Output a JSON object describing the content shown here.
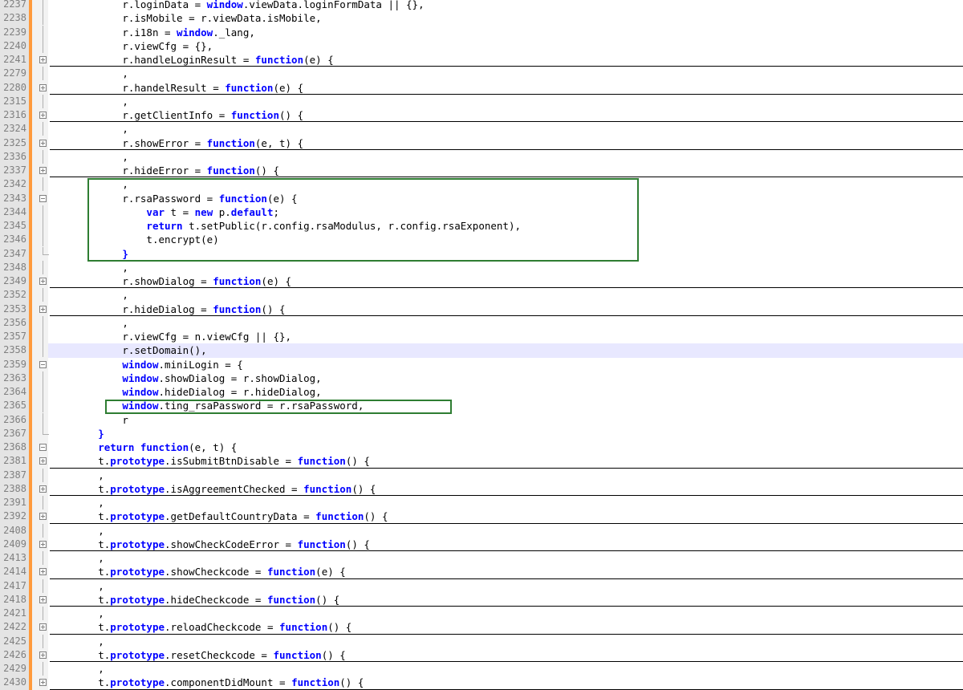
{
  "editor": {
    "lines": [
      {
        "num": "2237",
        "indent": "            ",
        "tokens": [
          {
            "t": "r.loginData = "
          },
          {
            "t": "window",
            "k": 1
          },
          {
            "t": ".viewData.loginFormData || {},"
          }
        ],
        "fold": "line"
      },
      {
        "num": "2238",
        "indent": "            ",
        "tokens": [
          {
            "t": "r.isMobile = r.viewData.isMobile,"
          }
        ],
        "fold": "line"
      },
      {
        "num": "2239",
        "indent": "            ",
        "tokens": [
          {
            "t": "r.i18n = "
          },
          {
            "t": "window",
            "k": 1
          },
          {
            "t": "._lang,"
          }
        ],
        "fold": "line"
      },
      {
        "num": "2240",
        "indent": "            ",
        "tokens": [
          {
            "t": "r.viewCfg = {},"
          }
        ],
        "fold": "line"
      },
      {
        "num": "2241",
        "indent": "            ",
        "tokens": [
          {
            "t": "r.handleLoginResult = "
          },
          {
            "t": "function",
            "k": 1
          },
          {
            "t": "(e) {"
          }
        ],
        "fold": "box",
        "folded": true
      },
      {
        "num": "2279",
        "indent": "            ",
        "tokens": [
          {
            "t": ","
          }
        ],
        "fold": "line"
      },
      {
        "num": "2280",
        "indent": "            ",
        "tokens": [
          {
            "t": "r.handelResult = "
          },
          {
            "t": "function",
            "k": 1
          },
          {
            "t": "(e) {"
          }
        ],
        "fold": "box",
        "folded": true
      },
      {
        "num": "2315",
        "indent": "            ",
        "tokens": [
          {
            "t": ","
          }
        ],
        "fold": "line"
      },
      {
        "num": "2316",
        "indent": "            ",
        "tokens": [
          {
            "t": "r.getClientInfo = "
          },
          {
            "t": "function",
            "k": 1
          },
          {
            "t": "() {"
          }
        ],
        "fold": "box",
        "folded": true
      },
      {
        "num": "2324",
        "indent": "            ",
        "tokens": [
          {
            "t": ","
          }
        ],
        "fold": "line"
      },
      {
        "num": "2325",
        "indent": "            ",
        "tokens": [
          {
            "t": "r.showError = "
          },
          {
            "t": "function",
            "k": 1
          },
          {
            "t": "(e, t) {"
          }
        ],
        "fold": "box",
        "folded": true
      },
      {
        "num": "2336",
        "indent": "            ",
        "tokens": [
          {
            "t": ","
          }
        ],
        "fold": "line"
      },
      {
        "num": "2337",
        "indent": "            ",
        "tokens": [
          {
            "t": "r.hideError = "
          },
          {
            "t": "function",
            "k": 1
          },
          {
            "t": "() {"
          }
        ],
        "fold": "box",
        "folded": true
      },
      {
        "num": "2342",
        "indent": "            ",
        "tokens": [
          {
            "t": ","
          }
        ],
        "fold": "line"
      },
      {
        "num": "2343",
        "indent": "            ",
        "tokens": [
          {
            "t": "r.rsaPassword = "
          },
          {
            "t": "function",
            "k": 1
          },
          {
            "t": "(e) {"
          }
        ],
        "fold": "box"
      },
      {
        "num": "2344",
        "indent": "                ",
        "tokens": [
          {
            "t": "var",
            "k": 1
          },
          {
            "t": " t = "
          },
          {
            "t": "new",
            "k": 1
          },
          {
            "t": " p."
          },
          {
            "t": "default",
            "k": 1
          },
          {
            "t": ";"
          }
        ],
        "fold": "line"
      },
      {
        "num": "2345",
        "indent": "                ",
        "tokens": [
          {
            "t": "return",
            "k": 1
          },
          {
            "t": " t.setPublic(r.config.rsaModulus, r.config.rsaExponent),"
          }
        ],
        "fold": "line"
      },
      {
        "num": "2346",
        "indent": "                ",
        "tokens": [
          {
            "t": "t.encrypt(e)"
          }
        ],
        "fold": "line"
      },
      {
        "num": "2347",
        "indent": "            ",
        "tokens": [
          {
            "t": "}",
            "k": 1
          }
        ],
        "fold": "end"
      },
      {
        "num": "2348",
        "indent": "            ",
        "tokens": [
          {
            "t": ","
          }
        ],
        "fold": "line"
      },
      {
        "num": "2349",
        "indent": "            ",
        "tokens": [
          {
            "t": "r.showDialog = "
          },
          {
            "t": "function",
            "k": 1
          },
          {
            "t": "(e) {"
          }
        ],
        "fold": "box",
        "folded": true
      },
      {
        "num": "2352",
        "indent": "            ",
        "tokens": [
          {
            "t": ","
          }
        ],
        "fold": "line"
      },
      {
        "num": "2353",
        "indent": "            ",
        "tokens": [
          {
            "t": "r.hideDialog = "
          },
          {
            "t": "function",
            "k": 1
          },
          {
            "t": "() {"
          }
        ],
        "fold": "box",
        "folded": true
      },
      {
        "num": "2356",
        "indent": "            ",
        "tokens": [
          {
            "t": ","
          }
        ],
        "fold": "line"
      },
      {
        "num": "2357",
        "indent": "            ",
        "tokens": [
          {
            "t": "r.viewCfg = n.viewCfg || {},"
          }
        ],
        "fold": "line"
      },
      {
        "num": "2358",
        "indent": "            ",
        "tokens": [
          {
            "t": "r.setDomain(),"
          }
        ],
        "fold": "line",
        "current": true
      },
      {
        "num": "2359",
        "indent": "            ",
        "tokens": [
          {
            "t": "window",
            "k": 1
          },
          {
            "t": ".miniLogin = {"
          }
        ],
        "fold": "box"
      },
      {
        "num": "2363",
        "indent": "            ",
        "tokens": [
          {
            "t": "window",
            "k": 1
          },
          {
            "t": ".showDialog = r.showDialog,"
          }
        ],
        "fold": "line"
      },
      {
        "num": "2364",
        "indent": "            ",
        "tokens": [
          {
            "t": "window",
            "k": 1
          },
          {
            "t": ".hideDialog = r.hideDialog,"
          }
        ],
        "fold": "line"
      },
      {
        "num": "2365",
        "indent": "            ",
        "tokens": [
          {
            "t": "window",
            "k": 1
          },
          {
            "t": ".ting_rsaPassword = r.rsaPassword,"
          }
        ],
        "fold": "line"
      },
      {
        "num": "2366",
        "indent": "            ",
        "tokens": [
          {
            "t": "r"
          }
        ],
        "fold": "line"
      },
      {
        "num": "2367",
        "indent": "        ",
        "tokens": [
          {
            "t": "}",
            "k": 1
          }
        ],
        "fold": "end"
      },
      {
        "num": "2368",
        "indent": "        ",
        "tokens": [
          {
            "t": "return",
            "k": 1
          },
          {
            "t": " "
          },
          {
            "t": "function",
            "k": 1
          },
          {
            "t": "(e, t) {"
          }
        ],
        "fold": "box"
      },
      {
        "num": "2381",
        "indent": "        ",
        "tokens": [
          {
            "t": "t."
          },
          {
            "t": "prototype",
            "k": 1
          },
          {
            "t": ".isSubmitBtnDisable = "
          },
          {
            "t": "function",
            "k": 1
          },
          {
            "t": "() {"
          }
        ],
        "fold": "box",
        "folded": true
      },
      {
        "num": "2387",
        "indent": "        ",
        "tokens": [
          {
            "t": ","
          }
        ],
        "fold": "line"
      },
      {
        "num": "2388",
        "indent": "        ",
        "tokens": [
          {
            "t": "t."
          },
          {
            "t": "prototype",
            "k": 1
          },
          {
            "t": ".isAggreementChecked = "
          },
          {
            "t": "function",
            "k": 1
          },
          {
            "t": "() {"
          }
        ],
        "fold": "box",
        "folded": true
      },
      {
        "num": "2391",
        "indent": "        ",
        "tokens": [
          {
            "t": ","
          }
        ],
        "fold": "line"
      },
      {
        "num": "2392",
        "indent": "        ",
        "tokens": [
          {
            "t": "t."
          },
          {
            "t": "prototype",
            "k": 1
          },
          {
            "t": ".getDefaultCountryData = "
          },
          {
            "t": "function",
            "k": 1
          },
          {
            "t": "() {"
          }
        ],
        "fold": "box",
        "folded": true
      },
      {
        "num": "2408",
        "indent": "        ",
        "tokens": [
          {
            "t": ","
          }
        ],
        "fold": "line"
      },
      {
        "num": "2409",
        "indent": "        ",
        "tokens": [
          {
            "t": "t."
          },
          {
            "t": "prototype",
            "k": 1
          },
          {
            "t": ".showCheckCodeError = "
          },
          {
            "t": "function",
            "k": 1
          },
          {
            "t": "() {"
          }
        ],
        "fold": "box",
        "folded": true
      },
      {
        "num": "2413",
        "indent": "        ",
        "tokens": [
          {
            "t": ","
          }
        ],
        "fold": "line"
      },
      {
        "num": "2414",
        "indent": "        ",
        "tokens": [
          {
            "t": "t."
          },
          {
            "t": "prototype",
            "k": 1
          },
          {
            "t": ".showCheckcode = "
          },
          {
            "t": "function",
            "k": 1
          },
          {
            "t": "(e) {"
          }
        ],
        "fold": "box",
        "folded": true
      },
      {
        "num": "2417",
        "indent": "        ",
        "tokens": [
          {
            "t": ","
          }
        ],
        "fold": "line"
      },
      {
        "num": "2418",
        "indent": "        ",
        "tokens": [
          {
            "t": "t."
          },
          {
            "t": "prototype",
            "k": 1
          },
          {
            "t": ".hideCheckcode = "
          },
          {
            "t": "function",
            "k": 1
          },
          {
            "t": "() {"
          }
        ],
        "fold": "box",
        "folded": true
      },
      {
        "num": "2421",
        "indent": "        ",
        "tokens": [
          {
            "t": ","
          }
        ],
        "fold": "line"
      },
      {
        "num": "2422",
        "indent": "        ",
        "tokens": [
          {
            "t": "t."
          },
          {
            "t": "prototype",
            "k": 1
          },
          {
            "t": ".reloadCheckcode = "
          },
          {
            "t": "function",
            "k": 1
          },
          {
            "t": "() {"
          }
        ],
        "fold": "box",
        "folded": true
      },
      {
        "num": "2425",
        "indent": "        ",
        "tokens": [
          {
            "t": ","
          }
        ],
        "fold": "line"
      },
      {
        "num": "2426",
        "indent": "        ",
        "tokens": [
          {
            "t": "t."
          },
          {
            "t": "prototype",
            "k": 1
          },
          {
            "t": ".resetCheckcode = "
          },
          {
            "t": "function",
            "k": 1
          },
          {
            "t": "() {"
          }
        ],
        "fold": "box",
        "folded": true
      },
      {
        "num": "2429",
        "indent": "        ",
        "tokens": [
          {
            "t": ","
          }
        ],
        "fold": "line"
      },
      {
        "num": "2430",
        "indent": "        ",
        "tokens": [
          {
            "t": "t."
          },
          {
            "t": "prototype",
            "k": 1
          },
          {
            "t": ".componentDidMount = "
          },
          {
            "t": "function",
            "k": 1
          },
          {
            "t": "() {"
          }
        ],
        "fold": "box",
        "folded": true
      }
    ],
    "highlights": [
      {
        "from_line": "2342",
        "to_line": "2347",
        "color": "#2e7d32"
      },
      {
        "from_line": "2365",
        "to_line": "2365",
        "color": "#2e7d32"
      }
    ],
    "colors": {
      "keyword": "#0000ff",
      "line_number": "#808080",
      "change_marker": "#ff9a3c",
      "current_line": "#e8e8ff"
    }
  }
}
